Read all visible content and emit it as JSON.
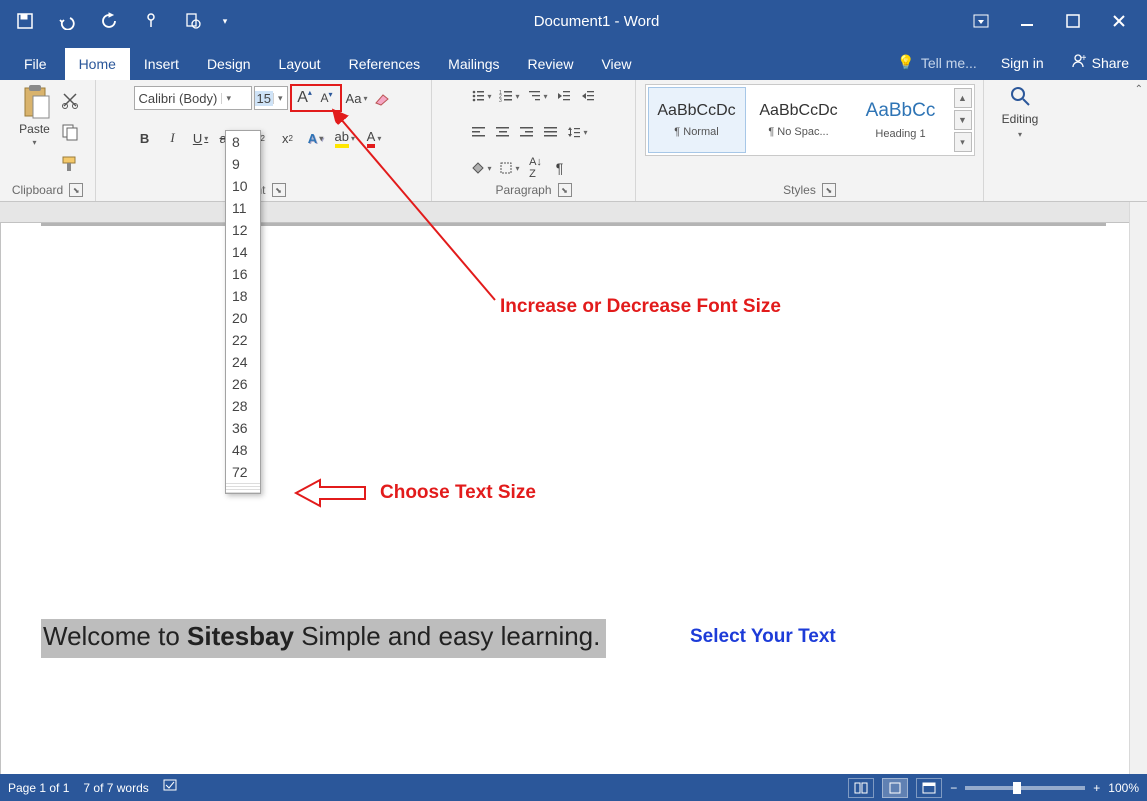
{
  "titlebar": {
    "doc_title": "Document1 - Word"
  },
  "tabs": {
    "file": "File",
    "home": "Home",
    "insert": "Insert",
    "design": "Design",
    "layout": "Layout",
    "references": "References",
    "mailings": "Mailings",
    "review": "Review",
    "view": "View",
    "tell_me": "Tell me...",
    "signin": "Sign in",
    "share": "Share"
  },
  "clipboard": {
    "paste": "Paste",
    "label": "Clipboard"
  },
  "font": {
    "name": "Calibri (Body)",
    "size": "15",
    "grow": "A",
    "shrink": "A",
    "case": "Aa",
    "bold": "B",
    "italic": "I",
    "underline": "U",
    "strike": "abc",
    "sub": "x",
    "sup": "x",
    "effects": "A",
    "highlight": "ab",
    "color": "A",
    "label": "Font"
  },
  "paragraph": {
    "label": "Paragraph"
  },
  "styles": {
    "normal_prev": "AaBbCcDc",
    "normal_name": "¶ Normal",
    "nospac_prev": "AaBbCcDc",
    "nospac_name": "¶ No Spac...",
    "h1_prev": "AaBbCc",
    "h1_name": "Heading 1",
    "label": "Styles"
  },
  "editing": {
    "label": "Editing"
  },
  "size_list": [
    "8",
    "9",
    "10",
    "11",
    "12",
    "14",
    "16",
    "18",
    "20",
    "22",
    "24",
    "26",
    "28",
    "36",
    "48",
    "72"
  ],
  "annotations": {
    "grow_shrink": "Increase or Decrease Font Size",
    "choose_size": "Choose Text Size",
    "select_text": "Select Your Text"
  },
  "document": {
    "pre": "Welcome to ",
    "bold": "Sitesbay",
    "post": " Simple and easy learning."
  },
  "status": {
    "page": "Page 1 of 1",
    "words": "7 of 7 words",
    "zoom": "100%"
  }
}
